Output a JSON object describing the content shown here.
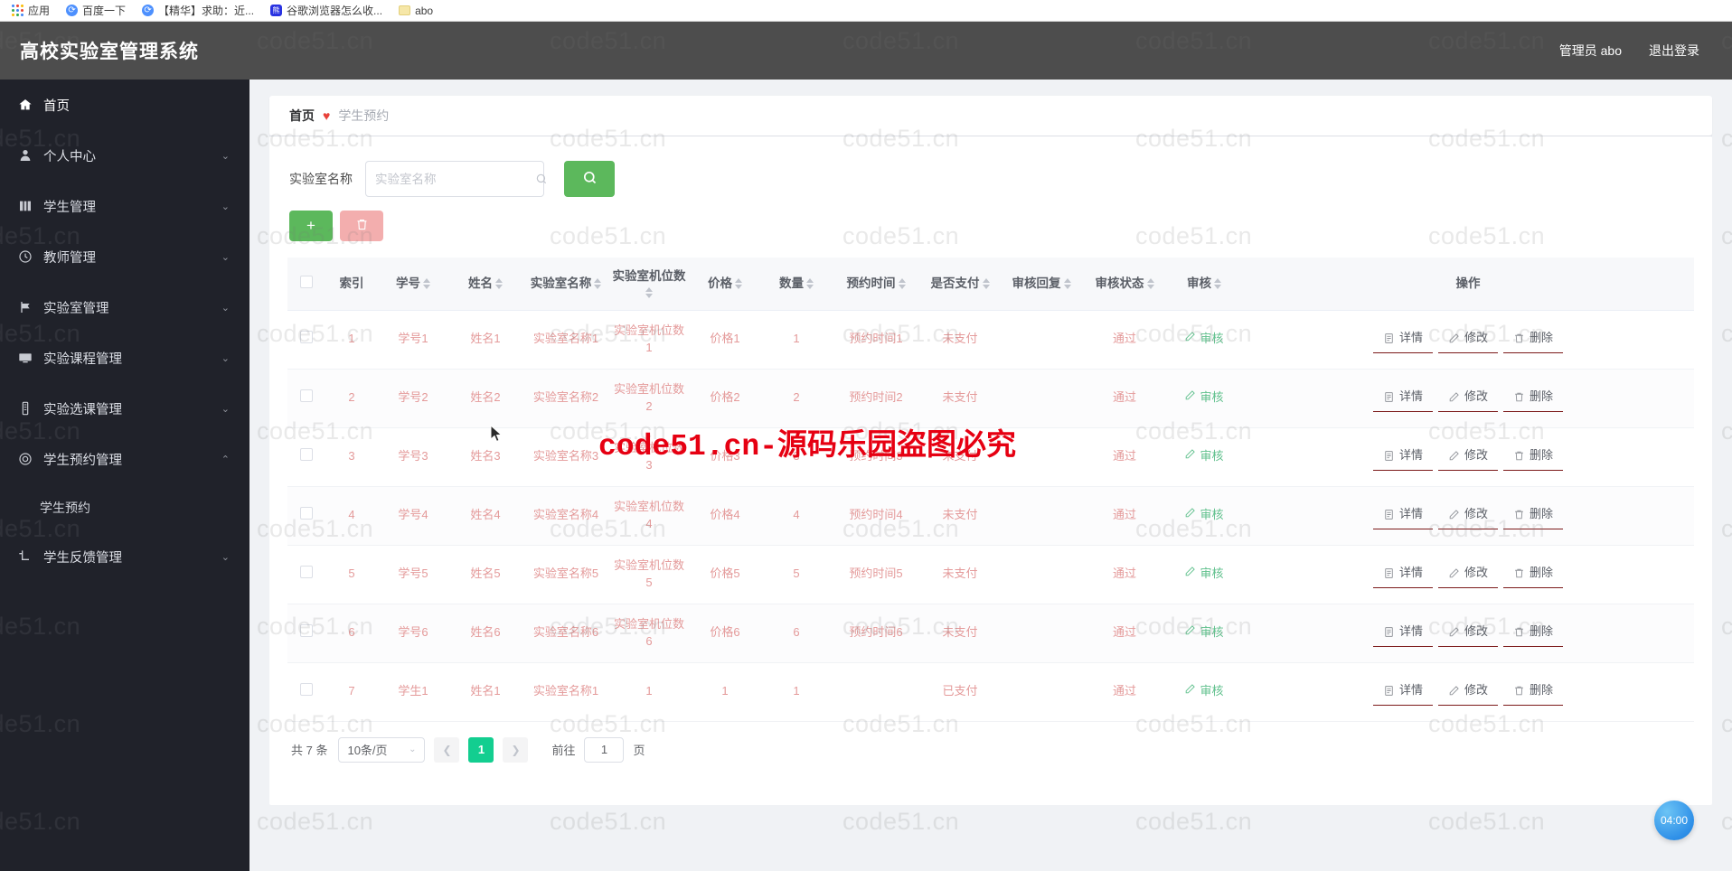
{
  "browser": {
    "bookmarks": [
      {
        "label": "应用",
        "icon": "apps-grid-icon"
      },
      {
        "label": "百度一下",
        "icon": "globe-icon"
      },
      {
        "label": "【精华】求助：近...",
        "icon": "globe-icon"
      },
      {
        "label": "谷歌浏览器怎么收...",
        "icon": "baidu-icon"
      },
      {
        "label": "abo",
        "icon": "folder-icon"
      }
    ]
  },
  "header": {
    "title": "高校实验室管理系统",
    "user_label": "管理员 abo",
    "logout_label": "退出登录"
  },
  "sidebar": {
    "items": [
      {
        "label": "首页",
        "icon": "home-icon",
        "arrow": "",
        "active": true
      },
      {
        "label": "个人中心",
        "icon": "user-icon",
        "arrow": "chevron-down-icon"
      },
      {
        "label": "学生管理",
        "icon": "book-icon",
        "arrow": "chevron-down-icon"
      },
      {
        "label": "教师管理",
        "icon": "compass-icon",
        "arrow": "chevron-down-icon"
      },
      {
        "label": "实验室管理",
        "icon": "flag-icon",
        "arrow": "chevron-down-icon"
      },
      {
        "label": "实验课程管理",
        "icon": "monitor-icon",
        "arrow": "chevron-down-icon"
      },
      {
        "label": "实验选课管理",
        "icon": "list-icon",
        "arrow": "chevron-down-icon"
      },
      {
        "label": "学生预约管理",
        "icon": "circle-icon",
        "arrow": "chevron-up-icon",
        "expanded": true
      },
      {
        "label": "学生反馈管理",
        "icon": "crop-icon",
        "arrow": "chevron-down-icon"
      }
    ],
    "submenu": {
      "label": "学生预约"
    }
  },
  "breadcrumb": {
    "home": "首页",
    "separator": "♥",
    "current": "学生预约"
  },
  "search": {
    "label": "实验室名称",
    "placeholder": "实验室名称",
    "value": "",
    "button_icon": "search-icon"
  },
  "toolbar": {
    "add_label": "+",
    "delete_icon": "trash-icon"
  },
  "table": {
    "columns": [
      {
        "key": "checkbox",
        "label": "",
        "sortable": false
      },
      {
        "key": "index",
        "label": "索引",
        "sortable": false
      },
      {
        "key": "student_no",
        "label": "学号",
        "sortable": true
      },
      {
        "key": "name",
        "label": "姓名",
        "sortable": true
      },
      {
        "key": "lab_name",
        "label": "实验室名称",
        "sortable": true
      },
      {
        "key": "seats",
        "label": "实验室机位数",
        "sortable": true
      },
      {
        "key": "price",
        "label": "价格",
        "sortable": true
      },
      {
        "key": "quantity",
        "label": "数量",
        "sortable": true
      },
      {
        "key": "reserve_time",
        "label": "预约时间",
        "sortable": true
      },
      {
        "key": "paid",
        "label": "是否支付",
        "sortable": true
      },
      {
        "key": "audit_reply",
        "label": "审核回复",
        "sortable": true
      },
      {
        "key": "audit_state",
        "label": "审核状态",
        "sortable": true
      },
      {
        "key": "audit",
        "label": "审核",
        "sortable": true
      },
      {
        "key": "ops",
        "label": "操作",
        "sortable": false
      }
    ],
    "rows": [
      {
        "index": "1",
        "student_no": "学号1",
        "name": "姓名1",
        "lab_name": "实验室名称1",
        "seats": "实验室机位数1",
        "price": "价格1",
        "quantity": "1",
        "reserve_time": "预约时间1",
        "paid": "未支付",
        "audit_reply": "",
        "audit_state": "通过",
        "audit": "审核"
      },
      {
        "index": "2",
        "student_no": "学号2",
        "name": "姓名2",
        "lab_name": "实验室名称2",
        "seats": "实验室机位数2",
        "price": "价格2",
        "quantity": "2",
        "reserve_time": "预约时间2",
        "paid": "未支付",
        "audit_reply": "",
        "audit_state": "通过",
        "audit": "审核"
      },
      {
        "index": "3",
        "student_no": "学号3",
        "name": "姓名3",
        "lab_name": "实验室名称3",
        "seats": "实验室机位数3",
        "price": "价格3",
        "quantity": "3",
        "reserve_time": "预约时间3",
        "paid": "未支付",
        "audit_reply": "",
        "audit_state": "通过",
        "audit": "审核"
      },
      {
        "index": "4",
        "student_no": "学号4",
        "name": "姓名4",
        "lab_name": "实验室名称4",
        "seats": "实验室机位数4",
        "price": "价格4",
        "quantity": "4",
        "reserve_time": "预约时间4",
        "paid": "未支付",
        "audit_reply": "",
        "audit_state": "通过",
        "audit": "审核"
      },
      {
        "index": "5",
        "student_no": "学号5",
        "name": "姓名5",
        "lab_name": "实验室名称5",
        "seats": "实验室机位数5",
        "price": "价格5",
        "quantity": "5",
        "reserve_time": "预约时间5",
        "paid": "未支付",
        "audit_reply": "",
        "audit_state": "通过",
        "audit": "审核"
      },
      {
        "index": "6",
        "student_no": "学号6",
        "name": "姓名6",
        "lab_name": "实验室名称6",
        "seats": "实验室机位数6",
        "price": "价格6",
        "quantity": "6",
        "reserve_time": "预约时间6",
        "paid": "未支付",
        "audit_reply": "",
        "audit_state": "通过",
        "audit": "审核"
      },
      {
        "index": "7",
        "student_no": "学生1",
        "name": "姓名1",
        "lab_name": "实验室名称1",
        "seats": "1",
        "price": "1",
        "quantity": "1",
        "reserve_time": "",
        "paid": "已支付",
        "audit_reply": "",
        "audit_state": "通过",
        "audit": "审核"
      }
    ],
    "ops": [
      {
        "label": "详情",
        "icon": "document-icon"
      },
      {
        "label": "修改",
        "icon": "pencil-icon"
      },
      {
        "label": "删除",
        "icon": "trash-icon"
      }
    ]
  },
  "pagination": {
    "total_label": "共 7 条",
    "page_size_label": "10条/页",
    "prev_icon": "chevron-left-icon",
    "next_icon": "chevron-right-icon",
    "pages": [
      "1"
    ],
    "current_page": "1",
    "jump_prefix": "前往",
    "jump_value": "1",
    "jump_suffix": "页"
  },
  "timer": {
    "value": "04:00"
  },
  "watermark": {
    "tile_text": "code51.cn",
    "center_text": "code51.cn-源码乐园盗图必究",
    "center_color": "#e60012"
  },
  "colors": {
    "header_bg": "#4d4d4d",
    "sidebar_bg": "#20222a",
    "primary_green": "#5cb85c",
    "pager_green": "#13ce90",
    "row_text": "#e49a9a",
    "breadcrumb_heart": "#e8413a"
  }
}
